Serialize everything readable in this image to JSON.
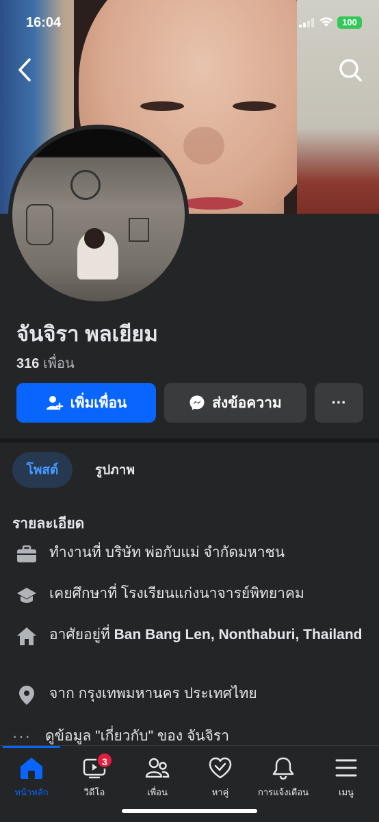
{
  "status_bar": {
    "time": "16:04",
    "battery": "100"
  },
  "profile": {
    "name": "จันจิรา พลเยียม",
    "friends_count": "316",
    "friends_label": "เพื่อน"
  },
  "actions": {
    "add_friend": "เพิ่มเพื่อน",
    "message": "ส่งข้อความ",
    "more": "···"
  },
  "tabs": [
    {
      "label": "โพสต์",
      "active": true
    },
    {
      "label": "รูปภาพ",
      "active": false
    }
  ],
  "details": {
    "title": "รายละเอียด",
    "work": "ทำงานที่ บริษัท พ่อกับแม่ จำกัดมหาชน",
    "education": "เคยศึกษาที่ โรงเรียนแก่งนาจารย์พิทยาคม",
    "lives_prefix": "อาศัยอยู่ที่ ",
    "lives_place": "Ban Bang Len, Nonthaburi, Thailand",
    "from": "จาก กรุงเทพมหานคร ประเทศไทย",
    "about_link": "ดูข้อมูล \"เกี่ยวกับ\" ของ จันจิรา"
  },
  "nav": {
    "items": [
      {
        "label": "หน้าหลัก",
        "icon": "home-icon",
        "active": true
      },
      {
        "label": "วิดีโอ",
        "icon": "video-icon",
        "badge": "3"
      },
      {
        "label": "เพื่อน",
        "icon": "friends-icon"
      },
      {
        "label": "หาคู่",
        "icon": "dating-icon"
      },
      {
        "label": "การแจ้งเตือน",
        "icon": "bell-icon"
      },
      {
        "label": "เมนู",
        "icon": "menu-icon"
      }
    ]
  },
  "colors": {
    "accent": "#0866ff",
    "background": "#242526",
    "surface": "#3a3b3c",
    "badge": "#e41e3f"
  }
}
